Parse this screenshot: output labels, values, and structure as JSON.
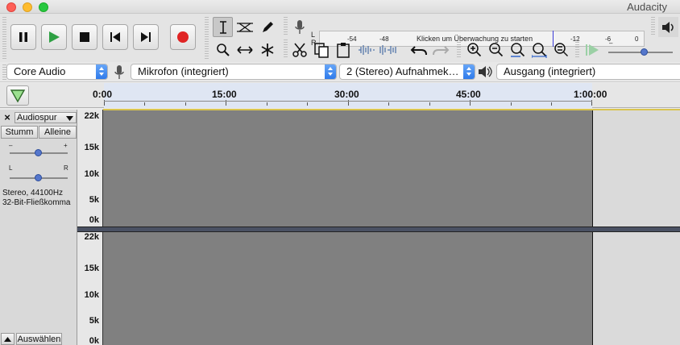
{
  "window": {
    "title": "Audacity"
  },
  "transport": {
    "buttons": [
      "pause",
      "play",
      "stop",
      "skip-start",
      "skip-end",
      "record"
    ]
  },
  "meter": {
    "channels": [
      "L",
      "R"
    ],
    "ticks": [
      "-54",
      "-48",
      "-12",
      "-6",
      "0"
    ],
    "message": "Klicken um Überwachung zu starten"
  },
  "devices": {
    "host": "Core Audio",
    "input": "Mikrofon (integriert)",
    "channels": "2 (Stereo) Aufnahmek…",
    "output": "Ausgang (integriert)"
  },
  "timeline": {
    "labels": [
      "0:00",
      "15:00",
      "30:00",
      "45:00",
      "1:00:00"
    ]
  },
  "track": {
    "name": "Audiospur",
    "mute_label": "Stumm",
    "solo_label": "Alleine",
    "gain_minus": "–",
    "gain_plus": "+",
    "pan_left": "L",
    "pan_right": "R",
    "info_rate": "Stereo, 44100Hz",
    "info_format": "32-Bit-Fließkomma",
    "select_label": "Auswählen",
    "scale_top": [
      "22k",
      "15k",
      "10k",
      "5k",
      "0k"
    ],
    "scale_bottom": [
      "22k",
      "15k",
      "10k",
      "5k",
      "0k"
    ]
  },
  "colors": {
    "record_red": "#e02424",
    "play_green": "#2ea043",
    "wave_bg": "#808080",
    "accent_blue": "#2b78ea"
  }
}
